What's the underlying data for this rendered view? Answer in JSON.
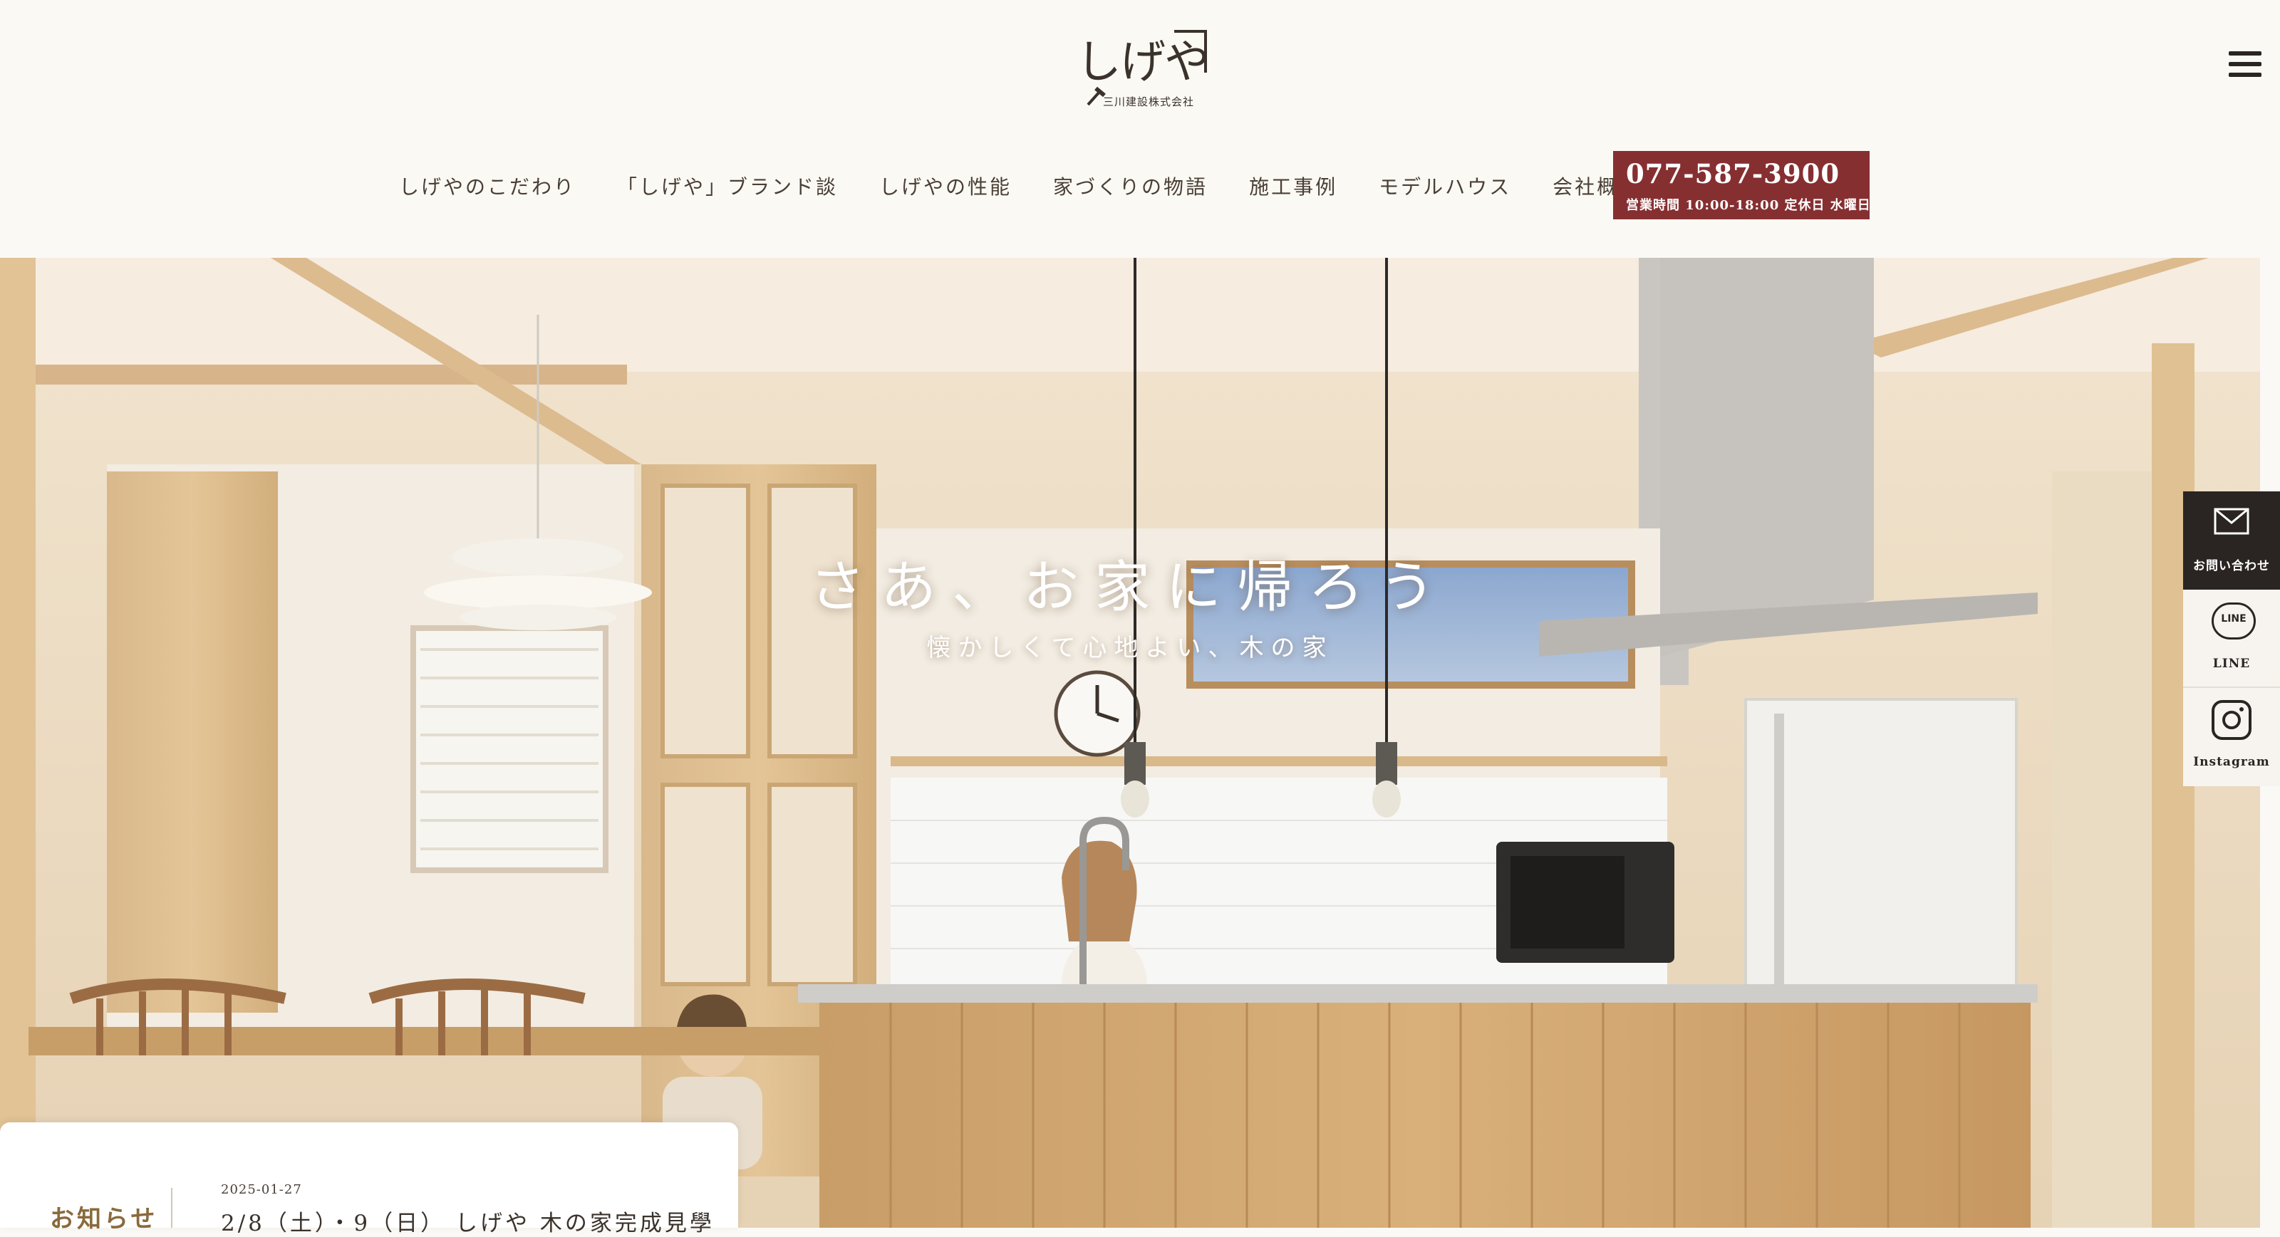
{
  "header": {
    "logo_text": "しげや",
    "logo_sub": "三川建設株式会社",
    "nav": [
      {
        "label": "しげやのこだわり"
      },
      {
        "label": "「しげや」ブランド談"
      },
      {
        "label": "しげやの性能"
      },
      {
        "label": "家づくりの物語"
      },
      {
        "label": "施工事例"
      },
      {
        "label": "モデルハウス"
      },
      {
        "label": "会社概要"
      }
    ],
    "contact": {
      "phone": "077-587-3900",
      "hours": "営業時間 10:00-18:00 定休日 水曜日"
    }
  },
  "hero": {
    "title": "さあ、お家に帰ろう",
    "subtitle": "懐かしくて心地よい、木の家"
  },
  "side_buttons": {
    "contact": "お問い合わせ",
    "line": "LINE",
    "line_icon_text": "LINE",
    "instagram": "Instagram"
  },
  "news": {
    "heading": "お知らせ",
    "date": "2025-01-27",
    "title": "2/8（土）・9（日） しげや 木の家完成見學"
  },
  "colors": {
    "accent": "#862f31",
    "background": "#fbf9f5",
    "news_heading": "#8a6a3c",
    "side_dark": "#2a2522"
  }
}
